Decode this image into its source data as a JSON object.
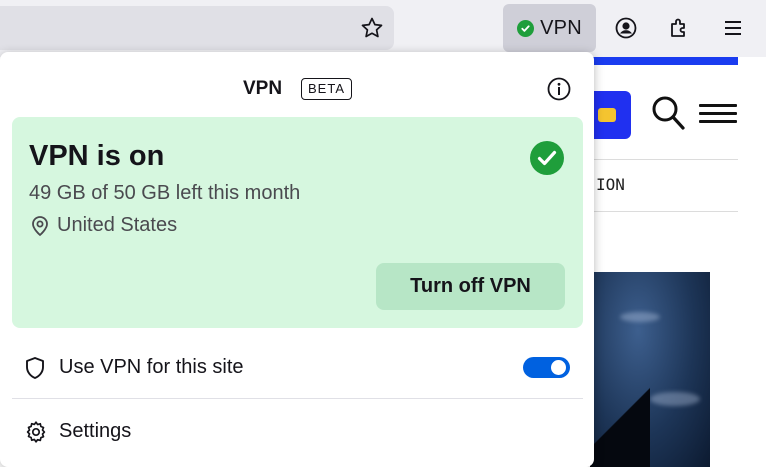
{
  "toolbar": {
    "vpn_button_label": "VPN",
    "icons": [
      "star-icon",
      "vpn-check-icon",
      "account-icon",
      "extensions-icon",
      "menu-icon"
    ]
  },
  "background_page": {
    "partial_label": "ION"
  },
  "panel": {
    "title": "VPN",
    "badge": "BETA",
    "status": {
      "title": "VPN is on",
      "usage": "49 GB of 50 GB left this month",
      "location": "United States",
      "turn_off_label": "Turn off VPN"
    },
    "site_toggle": {
      "label": "Use VPN for this site",
      "enabled": true
    },
    "settings_label": "Settings"
  },
  "colors": {
    "status_card_bg": "#d6f7df",
    "turn_off_btn_bg": "#b7e6c6",
    "check_green": "#1f9e3b",
    "toggle_blue": "#0061e0",
    "vpn_button_bg": "#cfcfd8"
  }
}
